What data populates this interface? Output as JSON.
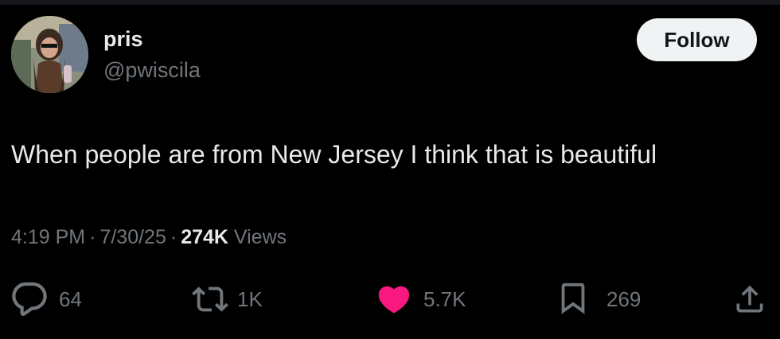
{
  "author": {
    "display_name": "pris",
    "handle": "@pwiscila"
  },
  "follow_label": "Follow",
  "tweet": {
    "text": "When people are from New Jersey I think that is beautiful"
  },
  "meta": {
    "time": "4:19 PM",
    "separator": "·",
    "date": "7/30/25",
    "views_count": "274K",
    "views_label": "Views"
  },
  "actions": {
    "replies": {
      "icon": "reply-icon",
      "count": "64"
    },
    "reposts": {
      "icon": "repost-icon",
      "count": "1K"
    },
    "likes": {
      "icon": "heart-icon",
      "count": "5.7K"
    },
    "bookmarks": {
      "icon": "bookmark-icon",
      "count": "269"
    },
    "share": {
      "icon": "share-icon"
    }
  },
  "colors": {
    "background": "#000000",
    "primary_text": "#e7e9ea",
    "secondary_text": "#71767b",
    "like_pink": "#f91880",
    "follow_button_bg": "#eff3f4"
  }
}
